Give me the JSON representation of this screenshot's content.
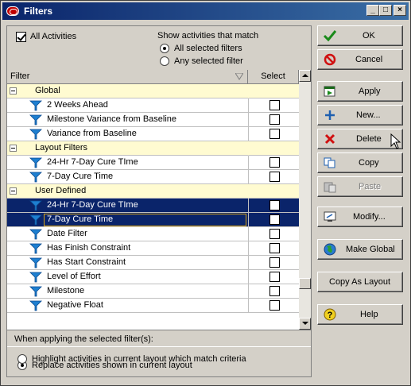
{
  "window": {
    "title": "Filters",
    "controls": {
      "minimize": "_",
      "maximize": "□",
      "close": "×"
    }
  },
  "top": {
    "all_activities_label": "All Activities",
    "all_activities_checked": true,
    "match_title": "Show activities that match",
    "match_options": [
      {
        "label": "All selected filters",
        "checked": true
      },
      {
        "label": "Any selected filter",
        "checked": false
      }
    ]
  },
  "grid": {
    "headers": {
      "filter": "Filter",
      "select": "Select"
    },
    "rows": [
      {
        "type": "group",
        "label": "Global"
      },
      {
        "type": "item",
        "label": "2 Weeks Ahead",
        "checked": false,
        "selected": false,
        "focused": false
      },
      {
        "type": "item",
        "label": "Milestone Variance from Baseline",
        "checked": false,
        "selected": false,
        "focused": false
      },
      {
        "type": "item",
        "label": "Variance from Baseline",
        "checked": false,
        "selected": false,
        "focused": false
      },
      {
        "type": "group",
        "label": "Layout Filters"
      },
      {
        "type": "item",
        "label": "24-Hr 7-Day Cure TIme",
        "checked": false,
        "selected": false,
        "focused": false
      },
      {
        "type": "item",
        "label": "7-Day Cure Time",
        "checked": false,
        "selected": false,
        "focused": false
      },
      {
        "type": "group",
        "label": "User Defined"
      },
      {
        "type": "item",
        "label": "24-Hr 7-Day Cure TIme",
        "checked": false,
        "selected": true,
        "focused": false
      },
      {
        "type": "item",
        "label": "7-Day Cure Time",
        "checked": false,
        "selected": true,
        "focused": true
      },
      {
        "type": "item",
        "label": "Date Filter",
        "checked": false,
        "selected": false,
        "focused": false
      },
      {
        "type": "item",
        "label": "Has Finish Constraint",
        "checked": false,
        "selected": false,
        "focused": false
      },
      {
        "type": "item",
        "label": "Has Start Constraint",
        "checked": false,
        "selected": false,
        "focused": false
      },
      {
        "type": "item",
        "label": "Level of Effort",
        "checked": false,
        "selected": false,
        "focused": false
      },
      {
        "type": "item",
        "label": "Milestone",
        "checked": false,
        "selected": false,
        "focused": false
      },
      {
        "type": "item",
        "label": "Negative Float",
        "checked": false,
        "selected": false,
        "focused": false
      }
    ]
  },
  "apply": {
    "title": "When applying the selected filter(s):",
    "options": [
      {
        "label": "Replace activities shown in current layout",
        "checked": true
      },
      {
        "label": "Highlight activities in current layout which match criteria",
        "checked": false
      }
    ]
  },
  "buttons": {
    "ok": "OK",
    "cancel": "Cancel",
    "apply": "Apply",
    "new": "New...",
    "delete": "Delete",
    "copy": "Copy",
    "paste": "Paste",
    "modify": "Modify...",
    "make_global": "Make Global",
    "copy_as_layout": "Copy As Layout",
    "help": "Help"
  },
  "colors": {
    "titlebar": "#0a246a",
    "group_row": "#fffbd1",
    "selected_row": "#0a246a",
    "funnel": "#1e7fd0"
  }
}
